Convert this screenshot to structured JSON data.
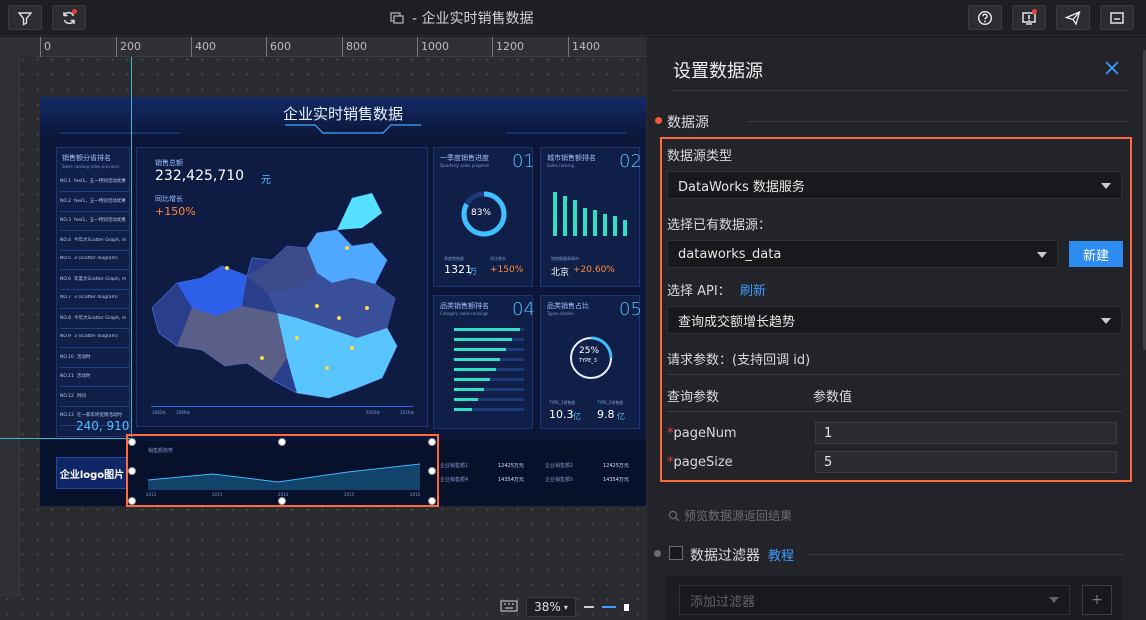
{
  "app": {
    "title": "- 企业实时销售数据"
  },
  "toolbar": {
    "left_buttons": [
      "filter-icon",
      "refresh-icon"
    ],
    "right_buttons": [
      "help-icon",
      "alert-icon",
      "publish-icon",
      "exit-icon"
    ]
  },
  "ruler": {
    "ticks": [
      "0",
      "200",
      "400",
      "600",
      "800",
      "1000",
      "1200",
      "1400"
    ]
  },
  "dashboard": {
    "title": "企业实时销售数据",
    "sales_rank_title": "销售额分省排名",
    "sales_rank_sub": "Sales ranking sales province",
    "rank_rows": [
      {
        "no": "NO.1",
        "text": "feel1，五一特别活动优惠"
      },
      {
        "no": "NO.2",
        "text": "feel1，五一特别活动优惠"
      },
      {
        "no": "NO.3",
        "text": "feel1，五一特别活动优惠"
      },
      {
        "no": "NO.4",
        "text": "今年大Scatter Graph, m"
      },
      {
        "no": "NO.5",
        "text": "3 (scatter diagram)"
      },
      {
        "no": "NO.6",
        "text": "年度大Scatter Graph, m"
      },
      {
        "no": "NO.7",
        "text": "3 (scatter diagram)"
      },
      {
        "no": "NO.8",
        "text": "今年大Scatter Graph, m"
      },
      {
        "no": "NO.9",
        "text": "3 (scatter diagram)"
      },
      {
        "no": "NO.10",
        "text": "活动时"
      },
      {
        "no": "NO.11",
        "text": "活动时"
      },
      {
        "no": "NO.12",
        "text": "时间"
      },
      {
        "no": "NO.13",
        "text": "在一家年终促销活动时"
      }
    ],
    "rank_total": "240, 910",
    "sales_label": "销售总额",
    "sales_value": "232,425,710",
    "sales_unit": "元",
    "growth_label": "同比增长",
    "growth_value": "+150%",
    "map_timeline": [
      "1982年",
      "1989年",
      "2000年",
      "2016年"
    ],
    "panel1": {
      "title": "一季度销售进度",
      "sub": "Quarterly sales progress",
      "num": "01",
      "gauge": "83%",
      "v1_label": "季度销售额",
      "v1": "1321",
      "v1_unit": "万",
      "v2_label": "同比增长",
      "v2": "+150%"
    },
    "panel2": {
      "title": "城市销售额排名",
      "sub": "Sales ranking",
      "num": "02",
      "v_label": "销售额最高城市",
      "city": "北京",
      "pct": "+20.60%"
    },
    "panel3": {
      "title": "品类销售额排名",
      "sub": "Category sales rankings",
      "num": "04"
    },
    "panel4": {
      "title": "品类销售占比",
      "sub": "Types ofsales",
      "num": "05",
      "gauge": "25%",
      "gauge_sub": "TYPE_3",
      "v1_label": "TYPE_1销售额",
      "v1": "10.3",
      "v1_unit": "亿",
      "v2_label": "TYPE_2销售额",
      "v2": "9.8",
      "v2_unit": "亿"
    },
    "logo": "企业logo图片",
    "bottom_chart_title": "销售额趋势",
    "bottom_chart_years": [
      "2012",
      "2013",
      "2014",
      "2015",
      "2016"
    ],
    "bottom_table": [
      {
        "label": "企业销售额1",
        "value": "12425万元"
      },
      {
        "label": "企业销售额4",
        "value": "14354万元"
      },
      {
        "label": "企业销售额2",
        "value": "12425万元"
      },
      {
        "label": "企业销售额5",
        "value": "14354万元"
      }
    ]
  },
  "zoom": {
    "value": "38%"
  },
  "panel": {
    "title": "设置数据源",
    "section_datasource": "数据源",
    "type_label": "数据源类型",
    "type_value": "DataWorks 数据服务",
    "existing_label": "选择已有数据源：",
    "existing_value": "dataworks_data",
    "new_button": "新建",
    "api_label": "选择 API：",
    "api_refresh": "刷新",
    "api_value": "查询成交额增长趋势",
    "params_label": "请求参数：(支持回调 id)",
    "col_param": "查询参数",
    "col_value": "参数值",
    "params": [
      {
        "name": "pageNum",
        "value": "1"
      },
      {
        "name": "pageSize",
        "value": "5"
      }
    ],
    "preview_link": "预览数据源返回结果",
    "filter_label": "数据过滤器",
    "filter_tutorial": "教程",
    "filter_placeholder": "添加过滤器",
    "add_label": "+"
  }
}
